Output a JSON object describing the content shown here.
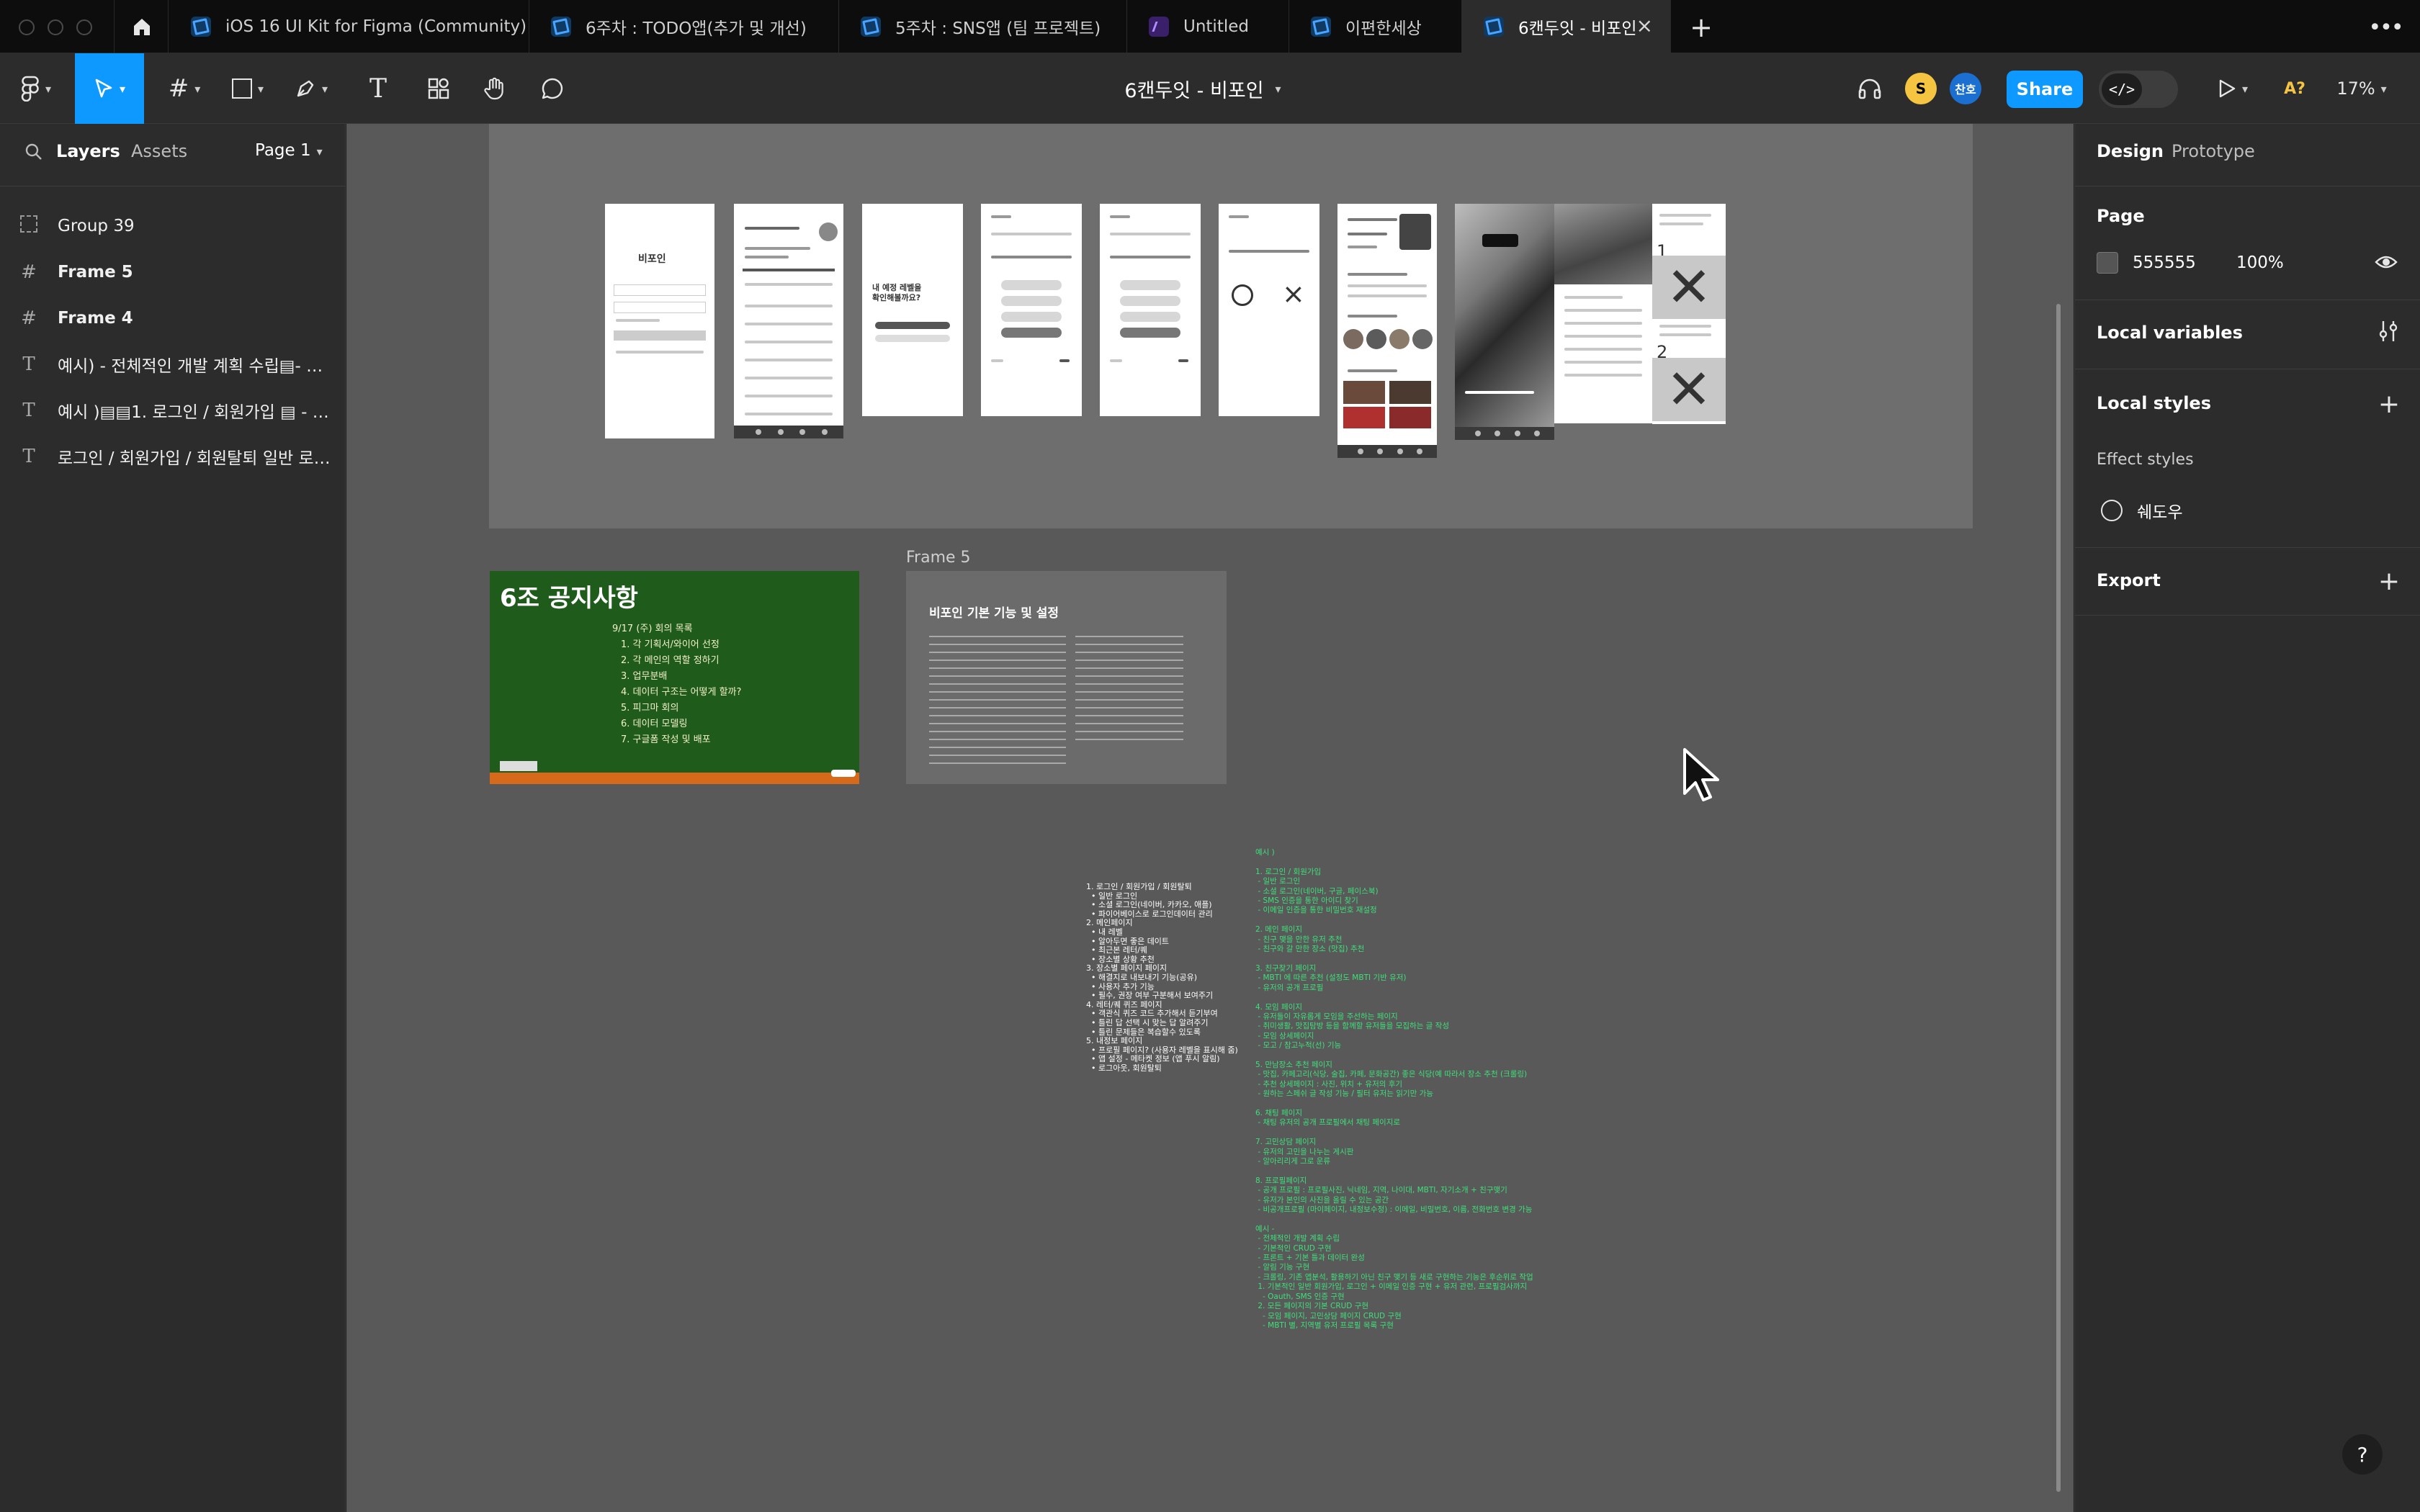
{
  "tabs": [
    {
      "label": "iOS 16 UI Kit for Figma (Community)",
      "icon": "figma-file-icon"
    },
    {
      "label": "6주차 : TODO앱(추가 및 개선)",
      "icon": "figma-file-icon"
    },
    {
      "label": "5주차 : SNS앱 (팀 프로젝트)",
      "icon": "figma-file-icon"
    },
    {
      "label": "Untitled",
      "icon": "figjam-file-icon"
    },
    {
      "label": "이편한세상",
      "icon": "figma-file-icon"
    },
    {
      "label": "6캔두잇 - 비포인",
      "icon": "figma-file-icon",
      "active": true
    }
  ],
  "toolbar": {
    "title": "6캔두잇 - 비포인",
    "avatars": [
      {
        "initial": "S",
        "color": "#f5c542"
      },
      {
        "initial": "찬호",
        "color": "#1a6fd1"
      }
    ],
    "share_label": "Share",
    "zoom": "17%",
    "ai_label": "A?"
  },
  "left_panel": {
    "tabs": [
      "Layers",
      "Assets"
    ],
    "page": "Page 1",
    "layers": [
      {
        "name": "Group 39",
        "icon": "group-icon"
      },
      {
        "name": "Frame 5",
        "icon": "frame-icon"
      },
      {
        "name": "Frame 4",
        "icon": "frame-icon"
      },
      {
        "name": "예시) - 전체적인 개발 계획 수립▤- 기본...",
        "icon": "text-icon"
      },
      {
        "name": "예시 )▤▤1. 로그인 / 회원가입 ▤ - 일반...",
        "icon": "text-icon"
      },
      {
        "name": "로그인 / 회원가입 / 회원탈퇴 일반 로그인...",
        "icon": "text-icon"
      }
    ]
  },
  "right_panel": {
    "tabs": [
      "Design",
      "Prototype"
    ],
    "page_heading": "Page",
    "page_color": "555555",
    "page_opacity": "100%",
    "local_variables": "Local variables",
    "local_styles": "Local styles",
    "effect_styles": "Effect styles",
    "effect_name": "쉐도우",
    "export": "Export"
  },
  "canvas": {
    "frame5_label": "Frame 5",
    "chalkboard_title": "6조 공지사항",
    "chalkboard_lines": [
      "9/17 (주) 회의 목록",
      "1. 각 기획서/와이어 선정",
      "2. 각 메인의 역할 정하기",
      "3. 업무분배",
      "4. 데이터 구조는 어떻게 할까?",
      "5. 피그마 회의",
      "6. 데이터 모델링",
      "7. 구글폼 작성 및 배포"
    ],
    "frame5_title": "비포인 기본 기능 및 설정",
    "phone_login_title": "비포인",
    "phone_q1": "내 예정 레벨을\n확인해볼까요?",
    "steps": [
      "1",
      "2"
    ],
    "white_list": "1. 로그인 / 회원가입 / 회원탈퇴\n  • 일반 로그인\n  • 소셜 로그인(네이버, 카카오, 애플)\n  • 파이어베이스로 로그인데이터 관리\n2. 메인페이지\n  • 내 레벨\n  • 알아두면 좋은 데이트\n  • 최근본 레터/퀘\n  • 장소별 상황 추천\n3. 장소별 페이지 페이지\n  • 해결지로 내보내기 기능(공유)\n  • 사용자 추가 기능\n  • 필수, 권장 여부 구분해서 보여주기\n4. 레터/퀘 퀴즈 페이지\n  • 객관식 퀴즈 코드 추가해서 듣기부여\n  • 틀린 답 선택 시 맞는 답 알려주기\n  • 틀린 문제들은 복습할수 있도록\n5. 내정보 페이지\n  • 프로필 페이지? (사용자 레벨을 표시해 줌)\n  • 앱 설정 - 메타켓 정보 (앱 푸시 알림)\n  • 로그아웃, 회원탈퇴",
    "green_list": "예시 )\n\n1. 로그인 / 회원가입\n - 일반 로그인\n - 소셜 로그인(네이버, 구글, 페이스북)\n - SMS 인증을 통한 아이디 찾기\n - 이메일 인증을 통한 비밀번호 재설정\n\n2. 메인 페이지\n - 친구 맺을 만한 유저 추천\n - 친구와 갈 만한 장소 (맛집) 추천\n\n3. 친구찾기 페이지\n - MBTI 에 따른 추천 (설정도 MBTI 기반 유저)\n - 유저의 공개 프로필\n\n4. 모임 페이지\n - 유저들이 자유롭게 모임을 주선하는 페이지\n - 취미생활, 맛집탐방 등을 함께할 유저들을 모집하는 글 작성\n - 모임 상세페이지\n - 모고 / 참고누적(선) 기능\n\n5. 만남장소 추천 페이지\n - 맛집, 카페고리(식당, 술집, 카페, 문화공간) 좋은 식당(예 따라서 장소 추천 (크롤링)\n - 추천 상세페이지 : 사진, 위치 + 유저의 후기\n - 원하는 스페쉬 글 작성 기능 / 필터 유저는 읽기만 가능\n\n6. 채팅 페이지\n - 채팅 유저의 공개 프로필에서 채팅 페이지로\n\n7. 고민상담 페이지\n - 유저의 고민을 나누는 게시판\n - 알아리리게 그로 운류\n\n8. 프로필페이지\n - 공개 프로필 : 프로필사진, 닉네임, 지역, 나이대, MBTI, 자기소개 + 친구맺기\n - 유저가 본인의 사진을 올릴 수 있는 공간\n - 비공개프로필 (마이페이지, 내정보수정) : 이메일, 비밀번호, 이름, 전화번호 변경 가능\n\n예시 -\n - 전체적인 개발 계획 수립\n - 기본적인 CRUD 구현\n - 프론트 + 기본 틀과 데이터 완성\n - 알림 기능 구현\n - 크롤링, 기존 앱분석, 활용하기 아닌 친구 맺기 등 새로 구현하는 기능은 후순위로 작업\n 1. 기본적인 일반 회원가입, 로그인 + 이메일 인증 구현 + 유저 관련, 프로필검사까지\n   - Oauth, SMS 인증 구현\n 2. 모든 페이지의 기본 CRUD 구현\n   - 모임 페이지, 고민상담 페이지 CRUD 구현\n   - MBTI 별, 지역별 유저 프로필 목록 구현"
  }
}
